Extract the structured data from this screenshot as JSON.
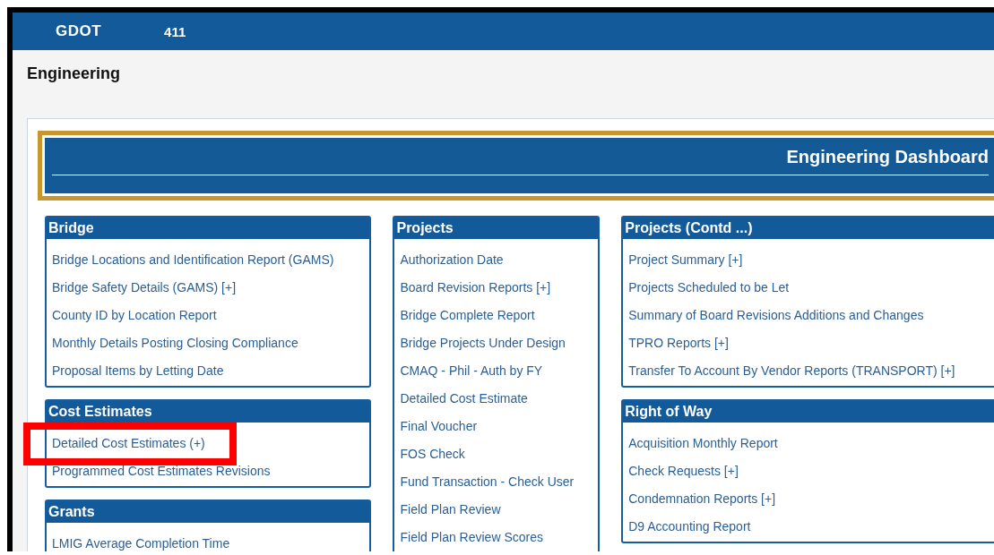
{
  "top_bar": {
    "logo": "GDOT",
    "number": "411"
  },
  "page_title": "Engineering",
  "dashboard": {
    "title": "Engineering Dashboard"
  },
  "columns": [
    {
      "sections": [
        {
          "title": "Bridge",
          "items": [
            {
              "label": "Bridge Locations and Identification Report (GAMS)"
            },
            {
              "label": "Bridge Safety Details (GAMS) [+]"
            },
            {
              "label": "County ID by Location Report"
            },
            {
              "label": "Monthly Details Posting Closing Compliance"
            },
            {
              "label": "Proposal Items by Letting Date"
            }
          ]
        },
        {
          "title": "Cost Estimates",
          "items": [
            {
              "label": "Detailed Cost Estimates (+)",
              "highlighted": true
            },
            {
              "label": "Programmed Cost Estimates Revisions",
              "highlighted": false
            }
          ]
        },
        {
          "title": "Grants",
          "items": [
            {
              "label": "LMIG Average Completion Time"
            }
          ]
        }
      ]
    },
    {
      "sections": [
        {
          "title": "Projects",
          "items": [
            {
              "label": "Authorization Date"
            },
            {
              "label": "Board Revision Reports [+]"
            },
            {
              "label": "Bridge Complete Report"
            },
            {
              "label": "Bridge Projects Under Design"
            },
            {
              "label": "CMAQ - Phil - Auth by FY"
            },
            {
              "label": "Detailed Cost Estimate"
            },
            {
              "label": "Final Voucher"
            },
            {
              "label": "FOS Check"
            },
            {
              "label": "Fund Transaction - Check User"
            },
            {
              "label": "Field Plan Review"
            },
            {
              "label": "Field Plan Review Scores"
            }
          ]
        }
      ]
    },
    {
      "sections": [
        {
          "title": "Projects (Contd ...)",
          "items": [
            {
              "label": "Project Summary [+]"
            },
            {
              "label": "Projects Scheduled to be Let"
            },
            {
              "label": "Summary of Board Revisions Additions and Changes"
            },
            {
              "label": "TPRO Reports [+]"
            },
            {
              "label": "Transfer To Account By Vendor Reports (TRANSPORT) [+]"
            }
          ]
        },
        {
          "title": "Right of Way",
          "items": [
            {
              "label": "Acquisition Monthly Report"
            },
            {
              "label": "Check Requests [+]"
            },
            {
              "label": "Condemnation Reports [+]"
            },
            {
              "label": "D9 Accounting Report"
            }
          ]
        }
      ]
    }
  ]
}
